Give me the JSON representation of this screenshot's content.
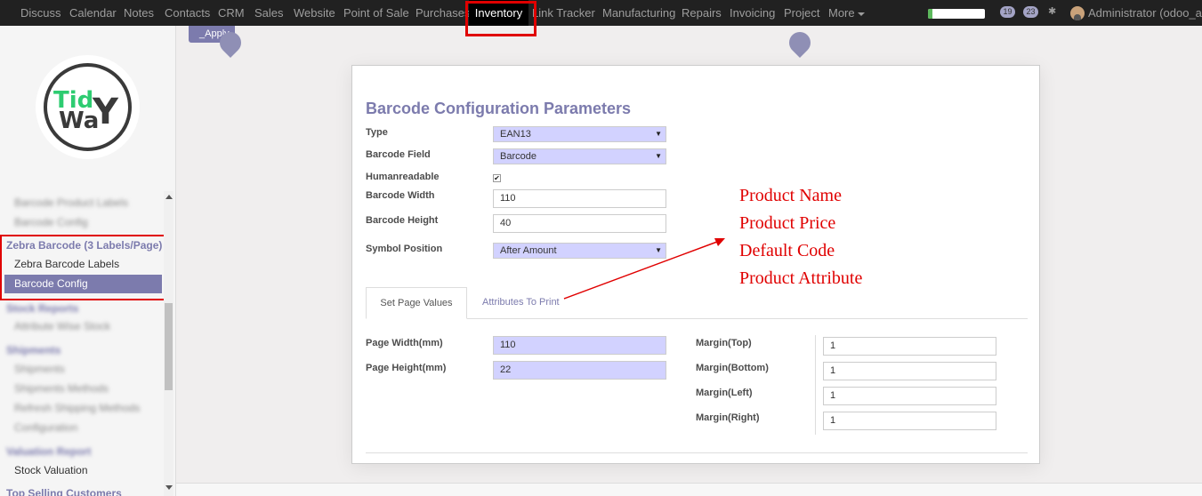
{
  "topnav": {
    "items": [
      "Discuss",
      "Calendar",
      "Notes",
      "Contacts",
      "CRM",
      "Sales",
      "Website",
      "Point of Sale",
      "Purchases",
      "Inventory",
      "Link Tracker",
      "Manufacturing",
      "Repairs",
      "Invoicing",
      "Project",
      "More"
    ],
    "active": "Inventory",
    "progress_fraction": 0.08,
    "messages_count": "19",
    "activities_count": "23",
    "user_label": "Administrator (odoo_ap..."
  },
  "breadcrumb": {
    "apply_label": "_Apply"
  },
  "sidebar": {
    "logo": {
      "line1": "Tid",
      "line2": "Wa",
      "mark": "Y"
    },
    "items": {
      "product_labels": "Barcode Product Labels",
      "barcode_config_top": "Barcode Config",
      "zebra_heading": "Zebra Barcode (3 Labels/Page)",
      "zebra_labels": "Zebra Barcode Labels",
      "zebra_config": "Barcode Config",
      "stock_reports": "Stock Reports",
      "attribute_wise_stock": "Attribute Wise Stock",
      "shipments_heading": "Shipments",
      "shipments": "Shipments",
      "shipments_methods": "Shipments Methods",
      "refresh_shipping": "Refresh Shipping Methods",
      "configuration": "Configuration",
      "valuation_heading": "Valuation Report",
      "stock_valuation": "Stock Valuation",
      "top_selling": "Top Selling Customers"
    }
  },
  "form": {
    "title": "Barcode Configuration Parameters",
    "type_label": "Type",
    "type_value": "EAN13",
    "field_label": "Barcode Field",
    "field_value": "Barcode",
    "humanreadable_label": "Humanreadable",
    "humanreadable_checked": "✔",
    "width_label": "Barcode Width",
    "width_value": "110",
    "height_label": "Barcode Height",
    "height_value": "40",
    "symbol_label": "Symbol Position",
    "symbol_value": "After Amount",
    "tabs": {
      "set_page": "Set Page Values",
      "attributes": "Attributes To Print"
    },
    "page_width_label": "Page Width(mm)",
    "page_width_value": "110",
    "page_height_label": "Page Height(mm)",
    "page_height_value": "22",
    "margin_top_label": "Margin(Top)",
    "margin_top_value": "1",
    "margin_bottom_label": "Margin(Bottom)",
    "margin_bottom_value": "1",
    "margin_left_label": "Margin(Left)",
    "margin_left_value": "1",
    "margin_right_label": "Margin(Right)",
    "margin_right_value": "1"
  },
  "annotation": {
    "lines": [
      "Product Name",
      "Product Price",
      "Default Code",
      "Product Attribute"
    ]
  },
  "colors": {
    "brand": "#7c7bad",
    "highlight_red": "#e00000",
    "required_field": "#d2d2ff"
  }
}
